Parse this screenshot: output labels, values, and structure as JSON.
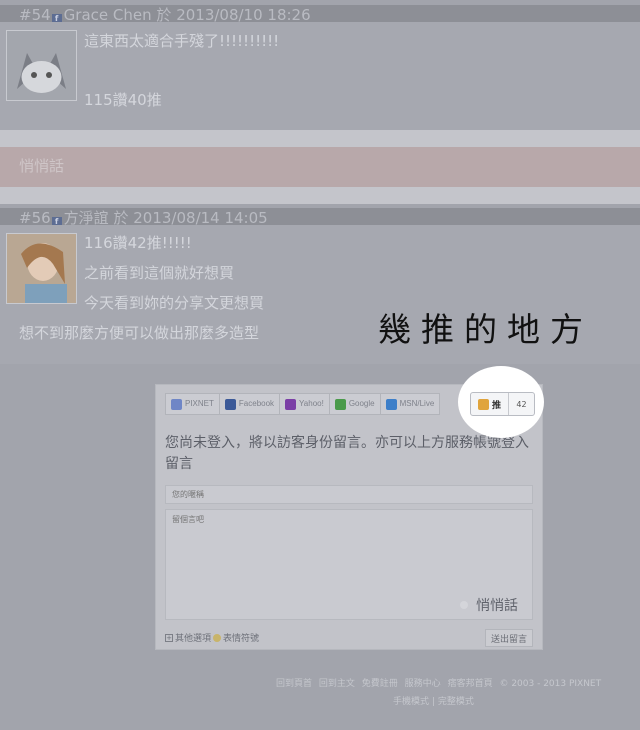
{
  "comments": [
    {
      "header": {
        "number": "#54",
        "author": "Grace Chen",
        "date_prefix": "於",
        "date": "2013/08/10 18:26"
      },
      "lines": [
        "這東西太適合手殘了!!!!!!!!!!",
        "115讚40推"
      ]
    },
    {
      "header": {
        "number": "#56",
        "author": "方淨誼",
        "date_prefix": "於",
        "date": "2013/08/14 14:05"
      },
      "lines": [
        "116讚42推!!!!!",
        "之前看到這個就好想買",
        "今天看到妳的分享文更想買",
        "想不到那麼方便可以做出那麼多造型"
      ]
    }
  ],
  "secret_bar": "悄悄話",
  "annotation": "幾推的地方",
  "form": {
    "services": [
      "PIXNET",
      "Facebook",
      "Yahoo!",
      "Google",
      "MSN/Live"
    ],
    "service_colors": [
      "#6f86c6",
      "#3b5998",
      "#7b3fa6",
      "#4a9a4a",
      "#3d7fc9"
    ],
    "push_label": "推",
    "push_count": "42",
    "hint": "您尚未登入，將以訪客身份留言。亦可以上方服務帳號登入留言",
    "name_placeholder": "您的暱稱",
    "message_placeholder": "留個言吧",
    "secret_option": "悄悄話",
    "other_options": "其他選項",
    "emoticons": "表情符號",
    "submit": "送出留言"
  },
  "footer": {
    "links": [
      "回到頁首",
      "回到主文",
      "免費註冊",
      "服務中心",
      "痞客邦首頁"
    ],
    "copyright": "© 2003 - 2013 PIXNET",
    "mobile": "手機模式",
    "separator": "|",
    "full": "完整模式"
  }
}
